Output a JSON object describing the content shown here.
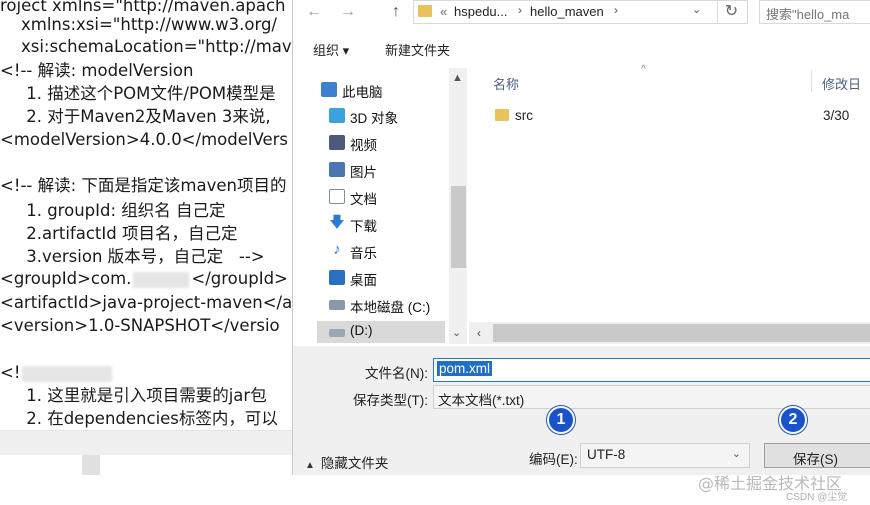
{
  "editor": {
    "lines": [
      "roject xmlns=\"http://maven.apach",
      "    xmlns:xsi=\"http://www.w3.org/",
      "    xsi:schemaLocation=\"http://mav",
      "<!-- 解读: modelVersion",
      "     1. 描述这个POM文件/POM模型是",
      "     2. 对于Maven2及Maven 3来说,",
      "<modelVersion>4.0.0</modelVers",
      "",
      "<!-- 解读: 下面是指定该maven项目的",
      "     1. groupId: 组织名 自己定",
      "     2.artifactId 项目名，自己定",
      "     3.version 版本号，自己定   -->",
      "<groupId>com.",
      "<artifactId>java-project-maven</a",
      "<version>1.0-SNAPSHOT</versio",
      "",
      "<!",
      "     1. 这里就是引入项目需要的jar包",
      "     2. 在dependencies标签内，可以"
    ],
    "group_tail": "</groupId>"
  },
  "address": {
    "back_icon": "back-arrow-icon",
    "forward_icon": "forward-arrow-icon",
    "up_icon": "up-arrow-icon",
    "prefix": "«",
    "crumb1": "hspedu...",
    "crumb2": "hello_maven",
    "refresh_icon": "refresh-icon",
    "search_placeholder": "搜索\"hello_ma"
  },
  "toolbar": {
    "organize": "组织 ▾",
    "new_folder": "新建文件夹"
  },
  "sidebar": {
    "items": [
      {
        "label": "此电脑",
        "icon": "computer-icon",
        "color": "#3d7fd0"
      },
      {
        "label": "3D 对象",
        "icon": "cube-3d-icon",
        "color": "#3aa2dc"
      },
      {
        "label": "视频",
        "icon": "video-icon",
        "color": "#4a5a78"
      },
      {
        "label": "图片",
        "icon": "picture-icon",
        "color": "#4a76b6"
      },
      {
        "label": "文档",
        "icon": "document-icon",
        "color": "#7f8da3"
      },
      {
        "label": "下载",
        "icon": "download-icon",
        "color": "#2a79d4"
      },
      {
        "label": "音乐",
        "icon": "music-icon",
        "color": "#2a79d4"
      },
      {
        "label": "桌面",
        "icon": "desktop-icon",
        "color": "#2a6fc4"
      },
      {
        "label": "本地磁盘 (C:)",
        "icon": "drive-icon",
        "color": "#8a98aa"
      },
      {
        "label": "(D:)",
        "icon": "drive-icon",
        "color": "#9aa6b4"
      }
    ]
  },
  "filelist": {
    "col_name": "名称",
    "col_modified": "修改日",
    "files": [
      {
        "name": "src",
        "date": "3/30",
        "icon": "folder-icon"
      }
    ]
  },
  "form": {
    "filename_label": "文件名(N):",
    "filename_value": "pom.xml",
    "filetype_label": "保存类型(T):",
    "filetype_value": "文本文档(*.txt)",
    "encoding_label": "编码(E):",
    "encoding_value": "UTF-8",
    "save_label": "保存(S)",
    "hide_folders_label": "隐藏文件夹"
  },
  "badges": {
    "one": "1",
    "two": "2"
  },
  "watermark": {
    "main": "@稀土掘金技术社区",
    "sub": "CSDN @尘觉"
  }
}
